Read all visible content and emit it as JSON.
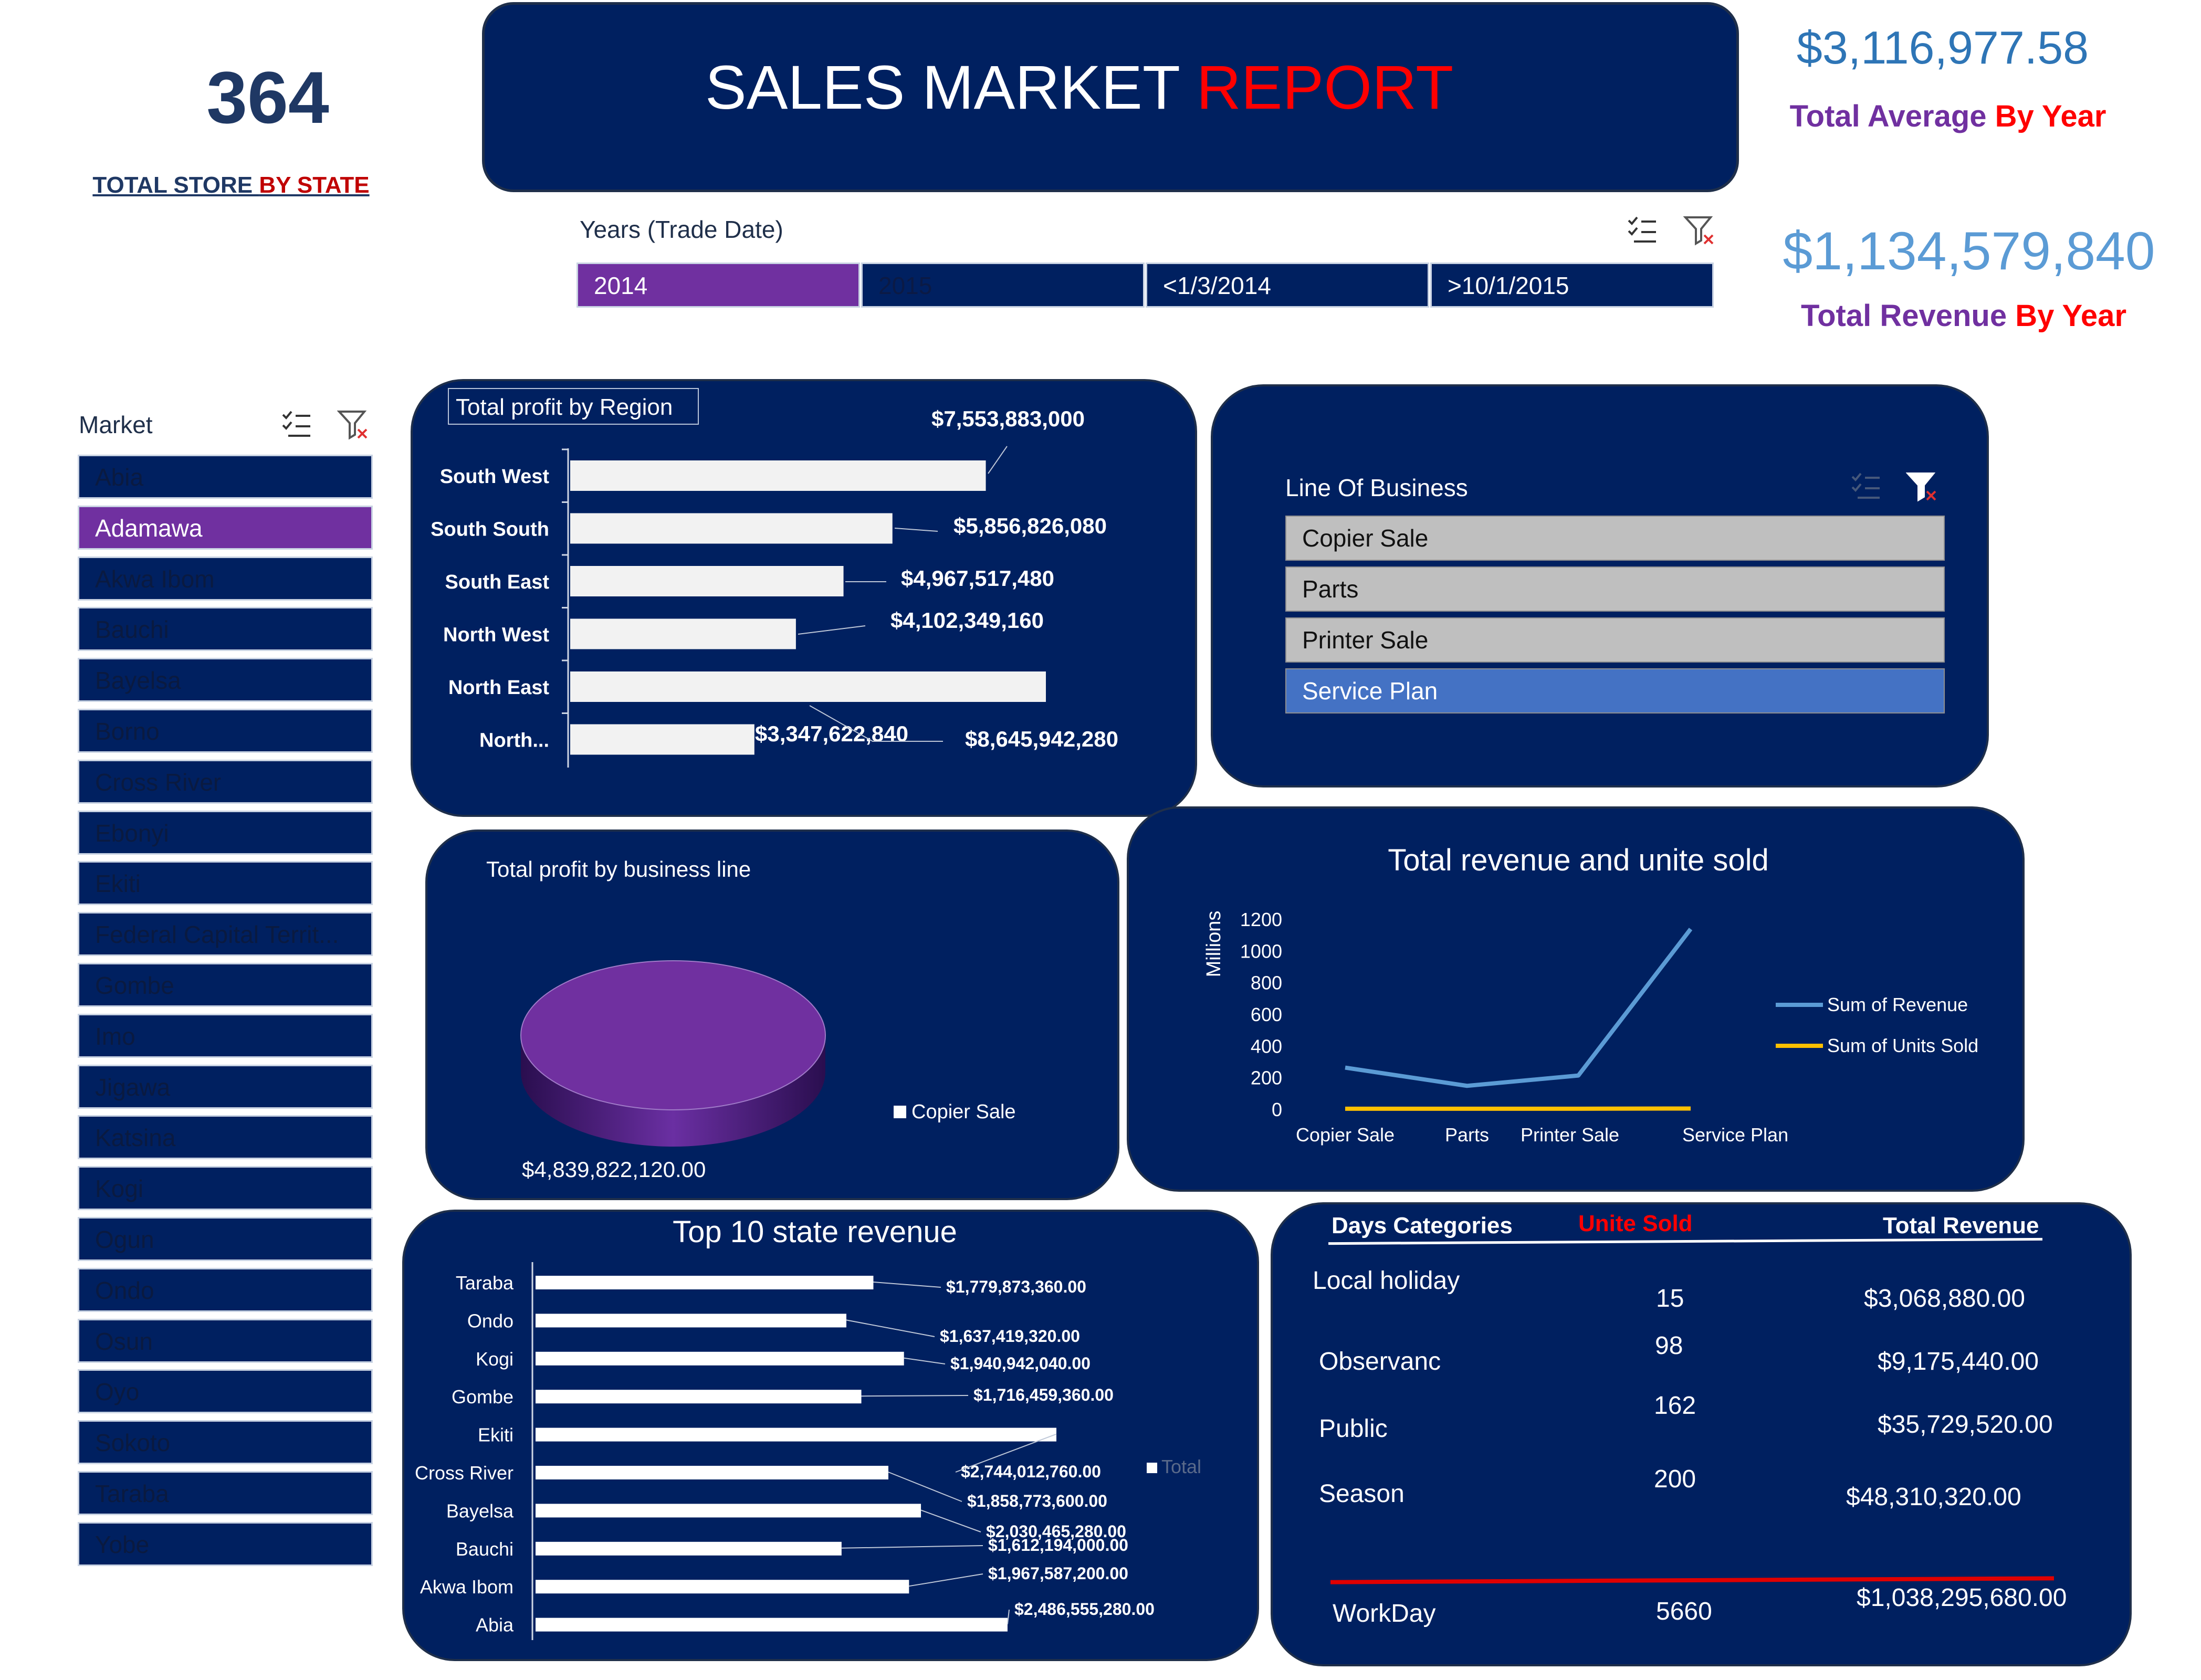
{
  "kpi": {
    "store_count": "364",
    "store_label_a": "TOTAL STORE ",
    "store_label_b": "BY STATE",
    "avg_value": "$3,116,977.58",
    "avg_label_a": "Total Average ",
    "avg_label_b": "By Year",
    "rev_value": "$1,134,579,840",
    "rev_label_a": "Total Revenue ",
    "rev_label_b": "By Year"
  },
  "header": {
    "title_a": "SALES MARKET ",
    "title_b": "REPORT"
  },
  "years_slicer": {
    "title": "Years (Trade Date)",
    "items": [
      {
        "label": "2014",
        "selected": true
      },
      {
        "label": "2015",
        "selected": false
      },
      {
        "label": "<1/3/2014",
        "selected": false
      },
      {
        "label": ">10/1/2015",
        "selected": false
      }
    ]
  },
  "market_slicer": {
    "title": "Market",
    "items": [
      {
        "label": "Abia"
      },
      {
        "label": "Adamawa",
        "selected": true
      },
      {
        "label": "Akwa Ibom"
      },
      {
        "label": "Bauchi"
      },
      {
        "label": "Bayelsa"
      },
      {
        "label": "Borno"
      },
      {
        "label": "Cross River"
      },
      {
        "label": "Ebonyi"
      },
      {
        "label": "Ekiti"
      },
      {
        "label": "Federal Capital Territ..."
      },
      {
        "label": "Gombe"
      },
      {
        "label": "Imo"
      },
      {
        "label": "Jigawa"
      },
      {
        "label": "Katsina"
      },
      {
        "label": "Kogi"
      },
      {
        "label": "Ogun"
      },
      {
        "label": "Ondo"
      },
      {
        "label": "Osun"
      },
      {
        "label": "Oyo"
      },
      {
        "label": "Sokoto"
      },
      {
        "label": "Taraba"
      },
      {
        "label": "Yobe"
      }
    ]
  },
  "lob_slicer": {
    "title": "Line Of Business",
    "items": [
      {
        "label": "Copier Sale"
      },
      {
        "label": "Parts"
      },
      {
        "label": "Printer Sale"
      },
      {
        "label": "Service Plan",
        "selected": true
      }
    ]
  },
  "chart_data": [
    {
      "id": "region",
      "type": "bar",
      "title": "Total profit by Region",
      "categories": [
        "South West",
        "South South",
        "South East",
        "North West",
        "North East",
        "North..."
      ],
      "values": [
        7553883000,
        5856826080,
        4967517480,
        4102349160,
        8645942280,
        3347622840
      ],
      "labels": [
        "$7,553,883,000",
        "$5,856,826,080",
        "$4,967,517,480",
        "$4,102,349,160",
        "$8,645,942,280",
        "$3,347,622,840"
      ]
    },
    {
      "id": "business_line",
      "type": "pie",
      "title": "Total profit by business line",
      "categories": [
        "Copier Sale"
      ],
      "values": [
        4839822120
      ],
      "labels": [
        "$4,839,822,120.00"
      ],
      "legend": "right"
    },
    {
      "id": "revenue_units",
      "type": "line",
      "title": "Total revenue and unite sold",
      "x": [
        "Copier Sale",
        "Parts",
        "Printer Sale",
        "Service Plan"
      ],
      "ylabel": "Millions",
      "ylim": [
        0,
        1200
      ],
      "yticks": [
        "1200",
        "1000",
        "800",
        "600",
        "400",
        "200",
        "0"
      ],
      "series": [
        {
          "name": "Sum of Revenue",
          "values": [
            260,
            145,
            210,
            1135
          ],
          "color": "#5b9bd5"
        },
        {
          "name": "Sum of Units Sold",
          "values": [
            0.6,
            0.5,
            0.6,
            1.8
          ],
          "color": "#ffc000"
        }
      ],
      "legend": "right"
    },
    {
      "id": "top_states",
      "type": "bar",
      "title": "Top 10 state revenue",
      "categories": [
        "Taraba",
        "Ondo",
        "Kogi",
        "Gombe",
        "Ekiti",
        "Cross River",
        "Bayelsa",
        "Bauchi",
        "Akwa Ibom",
        "Abia"
      ],
      "values": [
        1779873360,
        1637419320,
        1940942040,
        1716459360,
        2744012760,
        1858773600,
        2030465280,
        1612194000,
        1967587200,
        2486555280
      ],
      "labels": [
        "$1,779,873,360.00",
        "$1,637,419,320.00",
        "$1,940,942,040.00",
        "$1,716,459,360.00",
        "$2,744,012,760.00",
        "$1,858,773,600.00",
        "$2,030,465,280.00",
        "$1,612,194,000.00",
        "$1,967,587,200.00",
        "$2,486,555,280.00"
      ],
      "legend_label": "Total",
      "legend": "right"
    }
  ],
  "days_table": {
    "headers": [
      "Days Categories",
      "Unite Sold",
      "Total Revenue"
    ],
    "rows": [
      {
        "category": "Local holiday",
        "units": "15",
        "revenue": "$3,068,880.00"
      },
      {
        "category": "Observanc",
        "units": "98",
        "revenue": "$9,175,440.00"
      },
      {
        "category": "Public",
        "units": "162",
        "revenue": "$35,729,520.00"
      },
      {
        "category": "Season",
        "units": "200",
        "revenue": "$48,310,320.00"
      }
    ],
    "total": {
      "category": "WorkDay",
      "units": "5660",
      "revenue": "$1,038,295,680.00"
    }
  },
  "colors": {
    "navy": "#002060",
    "purple": "#7030a0",
    "red": "#ff0000",
    "kpi_blue": "#5b9bd5"
  }
}
